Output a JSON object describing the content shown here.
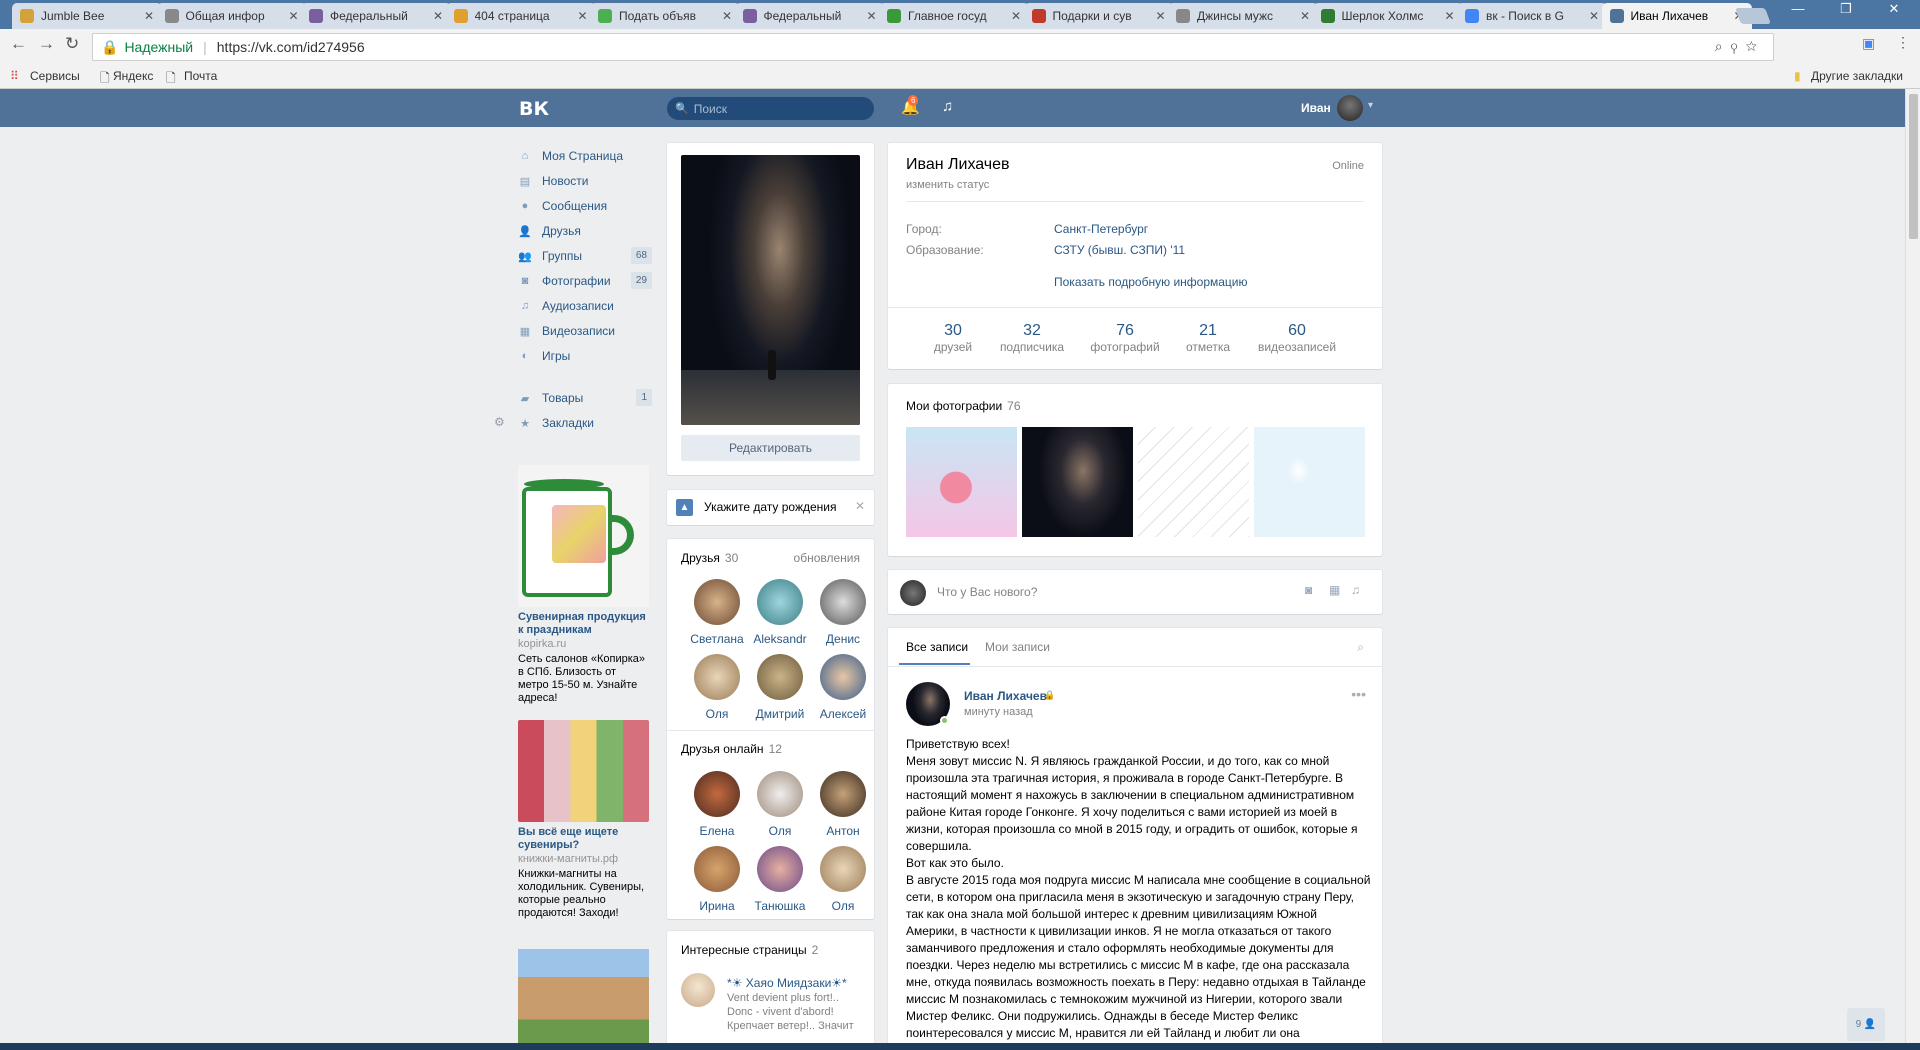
{
  "browser": {
    "tabs": [
      {
        "title": "Jumble Bee",
        "color": "#d4a23a"
      },
      {
        "title": "Общая инфор",
        "color": "#888888"
      },
      {
        "title": "Федеральный",
        "color": "#7a5fa0"
      },
      {
        "title": "404 страница",
        "color": "#e0a030"
      },
      {
        "title": "Подать объяв",
        "color": "#4caf50"
      },
      {
        "title": "Федеральный",
        "color": "#7a5fa0"
      },
      {
        "title": "Главное госуд",
        "color": "#3a9a3a"
      },
      {
        "title": "Подарки и сув",
        "color": "#c0392b"
      },
      {
        "title": "Джинсы мужс",
        "color": "#888888"
      },
      {
        "title": "Шерлок Холмс",
        "color": "#2e7d32"
      },
      {
        "title": "вк - Поиск в G",
        "color": "#4285f4"
      },
      {
        "title": "Иван Лихачев",
        "color": "#507299"
      }
    ],
    "security_label": "Надежный",
    "url": "https://vk.com/id274956",
    "bookmarks": [
      "Сервисы",
      "Яндекс",
      "Почта"
    ],
    "other_bookmarks": "Другие закладки"
  },
  "header": {
    "logo": "ВК",
    "search_placeholder": "Поиск",
    "notif_count": "6",
    "user_name": "Иван"
  },
  "menu": [
    {
      "label": "Моя Страница",
      "icon": "home-icon",
      "glyph": "⌂"
    },
    {
      "label": "Новости",
      "icon": "news-icon",
      "glyph": "▤"
    },
    {
      "label": "Сообщения",
      "icon": "messages-icon",
      "glyph": "●"
    },
    {
      "label": "Друзья",
      "icon": "friends-icon",
      "glyph": "👤"
    },
    {
      "label": "Группы",
      "icon": "groups-icon",
      "glyph": "👥",
      "count": "68"
    },
    {
      "label": "Фотографии",
      "icon": "camera-icon",
      "glyph": "◙",
      "count": "29"
    },
    {
      "label": "Аудиозаписи",
      "icon": "music-icon",
      "glyph": "♫"
    },
    {
      "label": "Видеозаписи",
      "icon": "video-icon",
      "glyph": "▦"
    },
    {
      "label": "Игры",
      "icon": "games-icon",
      "glyph": "◐"
    }
  ],
  "menu2": [
    {
      "label": "Товары",
      "icon": "goods-icon",
      "glyph": "▰",
      "count": "1"
    },
    {
      "label": "Закладки",
      "icon": "star-icon",
      "glyph": "★"
    }
  ],
  "ads": [
    {
      "title": "Сувенирная продукция к праздникам",
      "url": "kopirka.ru",
      "text": "Сеть салонов «Копирка» в СПб. Близость от метро 15-50 м. Узнайте адреса!"
    },
    {
      "title": "Вы всё еще ищете сувениры?",
      "url": "книжки-магниты.рф",
      "text": "Книжки-магниты на холодильник. Сувениры, которые реально продаются! Заходи!"
    }
  ],
  "profile": {
    "edit_button": "Редактировать",
    "birthday_prompt": "Укажите дату рождения",
    "name": "Иван Лихачев",
    "online": "Online",
    "status_link": "изменить статус",
    "city_label": "Город:",
    "city": "Санкт-Петербург",
    "edu_label": "Образование:",
    "edu": "СЗТУ (бывш. СЗПИ) '11",
    "more_info": "Показать подробную информацию",
    "counters": [
      {
        "value": "30",
        "label": "друзей"
      },
      {
        "value": "32",
        "label": "подписчика"
      },
      {
        "value": "76",
        "label": "фотографий"
      },
      {
        "value": "21",
        "label": "отметка"
      },
      {
        "value": "60",
        "label": "видеозаписей"
      }
    ]
  },
  "friends": {
    "title": "Друзья",
    "count": "30",
    "updates": "обновления",
    "list": [
      "Светлана",
      "Aleksandr",
      "Денис",
      "Оля",
      "Дмитрий",
      "Алексей"
    ]
  },
  "friends_online": {
    "title": "Друзья онлайн",
    "count": "12",
    "list": [
      "Елена",
      "Оля",
      "Антон",
      "Ирина",
      "Танюшка",
      "Оля"
    ]
  },
  "pages": {
    "title": "Интересные страницы",
    "count": "2",
    "item_name": "*☀ Хаяо Миядзаки☀*",
    "item_text": "Vent devient plus fort!.. Donc - vivent d'abord! Крепчает ветер!.. Значит"
  },
  "photos": {
    "title": "Мои фотографии",
    "count": "76"
  },
  "composer": {
    "placeholder": "Что у Вас нового?"
  },
  "wall_tabs": [
    "Все записи",
    "Мои записи"
  ],
  "post": {
    "author": "Иван Лихачев",
    "time": "минуту назад",
    "lines": [
      "Приветствую всех!",
      "Меня зовут миссис N. Я являюсь гражданкой России, и до того, как со мной",
      "произошла эта трагичная история, я проживала в городе Санкт-Петербурге. В",
      "настоящий момент я нахожусь в заключении в специальном административном",
      "районе Китая городе Гонконге. Я хочу поделиться с вами историей из моей в",
      "жизни, которая произошла со мной в 2015 году, и оградить от ошибок, которые я",
      "совершила.",
      "Вот как это было.",
      "В августе 2015 года моя подруга миссис М написала мне сообщение в социальной",
      "сети, в котором она пригласила меня в экзотическую и загадочную страну Перу,",
      "так как она знала мой большой интерес к древним цивилизациям Южной",
      "Америки, в частности к цивилизации инков. Я не могла отказаться от такого",
      "заманчивого предложения и стало оформлять необходимые документы для",
      "поездки. Через неделю мы встретились с миссис М в кафе, где она рассказала",
      "мне, откуда появилась возможность поехать в Перу: недавно отдыхая в Тайланде",
      "миссис М познакомилась с темнокожим мужчиной из Нигерии, которого звали",
      "Мистер Феликс. Они подружились. Однажды в беседе Мистер Феликс",
      "поинтересовался у миссис М, нравится ли ей Тайланд и любит ли она"
    ]
  },
  "chat_count": "9"
}
